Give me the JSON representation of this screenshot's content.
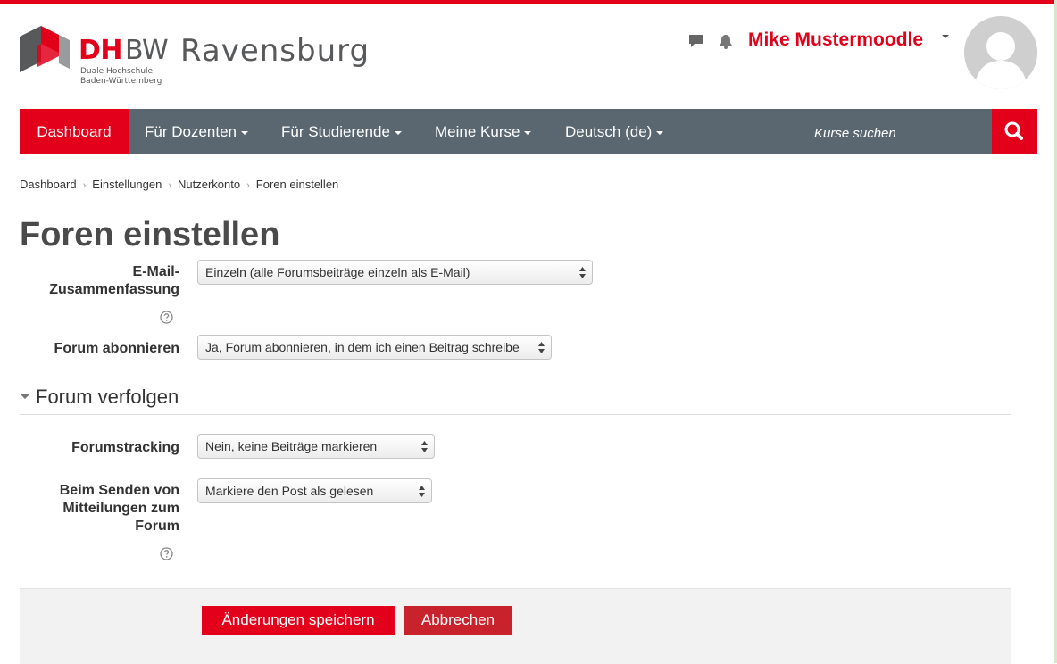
{
  "brand": {
    "short_red": "DH",
    "short_gray": "BW",
    "city": "Ravensburg",
    "subline_1": "Duale Hochschule",
    "subline_2": "Baden-Württemberg",
    "color_red": "#e2001a",
    "color_gray": "#58595b"
  },
  "user": {
    "name": "Mike Mustermoodle",
    "icons": [
      "message-icon",
      "bell-icon",
      "avatar"
    ]
  },
  "nav": {
    "items": [
      {
        "label": "Dashboard",
        "active": true
      },
      {
        "label": "Für Dozenten",
        "dropdown": true
      },
      {
        "label": "Für Studierende",
        "dropdown": true
      },
      {
        "label": "Meine Kurse",
        "dropdown": true
      },
      {
        "label": "Deutsch (de)",
        "dropdown": true
      }
    ],
    "search_placeholder": "Kurse suchen",
    "bar_color": "#5a6770"
  },
  "breadcrumb": [
    "Dashboard",
    "Einstellungen",
    "Nutzerkonto",
    "Foren einstellen"
  ],
  "page": {
    "title": "Foren einstellen"
  },
  "form": {
    "email_digest": {
      "label_1": "E-Mail-",
      "label_2": "Zusammenfassung",
      "value": "Einzeln (alle Forumsbeiträge einzeln als E-Mail)"
    },
    "subscribe": {
      "label": "Forum abonnieren",
      "value": "Ja, Forum abonnieren, in dem ich einen Beitrag schreibe"
    },
    "section": {
      "title": "Forum verfolgen"
    },
    "tracking": {
      "label": "Forumstracking",
      "value": "Nein, keine Beiträge markieren"
    },
    "mark_read": {
      "label_1": "Beim Senden von",
      "label_2": "Mitteilungen zum",
      "label_3": "Forum",
      "value": "Markiere den Post als gelesen"
    },
    "save_label": "Änderungen speichern",
    "cancel_label": "Abbrechen"
  }
}
